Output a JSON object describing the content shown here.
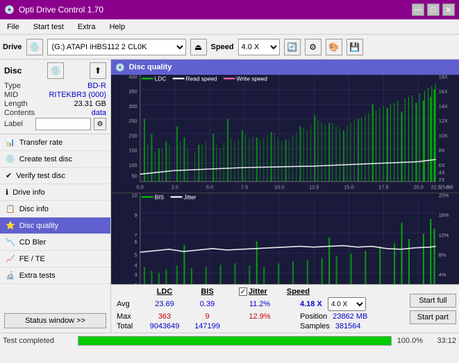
{
  "titleBar": {
    "title": "Opti Drive Control 1.70",
    "icon": "💿",
    "buttons": [
      "—",
      "□",
      "✕"
    ]
  },
  "menuBar": {
    "items": [
      "File",
      "Start test",
      "Extra",
      "Help"
    ]
  },
  "toolbar": {
    "driveLabel": "Drive",
    "driveValue": "(G:) ATAPI iHBS112 2 CL0K",
    "speedLabel": "Speed",
    "speedValue": "4.0 X"
  },
  "sidebar": {
    "discSection": {
      "title": "Disc",
      "fields": [
        {
          "label": "Type",
          "value": "BD-R",
          "color": "blue"
        },
        {
          "label": "MID",
          "value": "RITEKBR3 (000)",
          "color": "blue"
        },
        {
          "label": "Length",
          "value": "23.31 GB",
          "color": "black"
        },
        {
          "label": "Contents",
          "value": "data",
          "color": "blue"
        },
        {
          "label": "Label",
          "value": "",
          "color": "black"
        }
      ]
    },
    "navItems": [
      {
        "label": "Transfer rate",
        "icon": "📊",
        "active": false
      },
      {
        "label": "Create test disc",
        "icon": "💿",
        "active": false
      },
      {
        "label": "Verify test disc",
        "icon": "✔",
        "active": false
      },
      {
        "label": "Drive info",
        "icon": "ℹ",
        "active": false
      },
      {
        "label": "Disc info",
        "icon": "📋",
        "active": false
      },
      {
        "label": "Disc quality",
        "icon": "⭐",
        "active": true
      },
      {
        "label": "CD Bler",
        "icon": "📉",
        "active": false
      },
      {
        "label": "FE / TE",
        "icon": "📈",
        "active": false
      },
      {
        "label": "Extra tests",
        "icon": "🔬",
        "active": false
      }
    ],
    "statusBtn": "Status window >>"
  },
  "contentHeader": {
    "icon": "💿",
    "title": "Disc quality"
  },
  "chart1": {
    "legend": [
      "LDC",
      "Read speed",
      "Write speed"
    ],
    "legendColors": [
      "#00cc00",
      "#ffffff",
      "#ff69b4"
    ],
    "yAxisMax": 400,
    "yAxisRight": [
      "18X",
      "16X",
      "14X",
      "12X",
      "10X",
      "8X",
      "6X",
      "4X",
      "2X"
    ],
    "xAxisMax": 25
  },
  "chart2": {
    "legend": [
      "BIS",
      "Jitter"
    ],
    "legendColors": [
      "#00cc00",
      "#ffffff"
    ],
    "yAxisMax": 10,
    "yAxisRight": [
      "20%",
      "16%",
      "12%",
      "8%",
      "4%"
    ],
    "xAxisMax": 25
  },
  "stats": {
    "headers": [
      "LDC",
      "BIS",
      "",
      "Jitter",
      "Speed",
      ""
    ],
    "rows": [
      {
        "label": "Avg",
        "ldc": "23.69",
        "bis": "0.39",
        "jitter": "11.2%",
        "speed": "4.18 X",
        "speedSelect": "4.0 X"
      },
      {
        "label": "Max",
        "ldc": "363",
        "bis": "9",
        "jitter": "12.9%",
        "position": "23862 MB"
      },
      {
        "label": "Total",
        "ldc": "9043649",
        "bis": "147199",
        "samples": "381564"
      }
    ],
    "jitterChecked": true,
    "positionLabel": "Position",
    "samplesLabel": "Samples"
  },
  "bottomBar": {
    "progressPercent": 100,
    "statusText": "Test completed",
    "timeText": "33:12"
  },
  "colors": {
    "titleBarBg": "#8B008B",
    "activeNav": "#6060d0",
    "contentHeaderBg": "#6060d0",
    "chartBg": "#1a1a3a",
    "progressGreen": "#00cc00"
  }
}
